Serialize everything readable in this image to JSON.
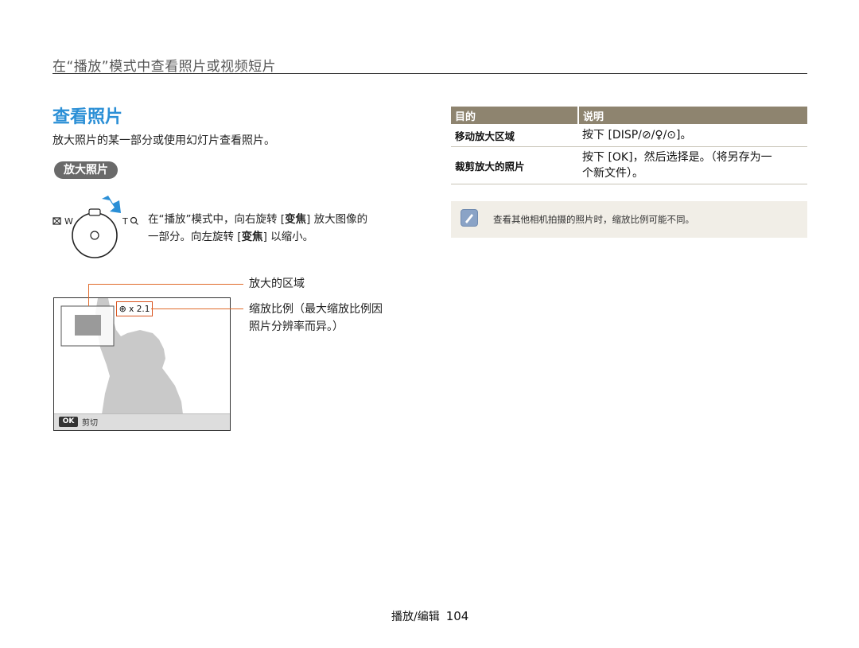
{
  "section_title": "在“播放”模式中查看照片或视频短片",
  "heading": "查看照片",
  "intro": "放大照片的某一部分或使用幻灯片查看照片。",
  "subsection": "放大照片",
  "dial": {
    "w_label": "W",
    "t_label": "T",
    "text_line1_pre": "在“播放”模式中，向右旋转 [",
    "text_line1_key": "变焦",
    "text_line1_post": "] 放大图像的",
    "text_line2_pre": "一部分。向左旋转 [",
    "text_line2_key": "变焦",
    "text_line2_post": "] 以缩小。"
  },
  "lcd": {
    "zoom_value": "x 2.1",
    "ok_button": "OK",
    "crop_label": "剪切"
  },
  "callouts": {
    "zoom_area": "放大的区域",
    "ratio_line1": "缩放比例（最大缩放比例因",
    "ratio_line2": "照片分辨率而异。）"
  },
  "table": {
    "headers": [
      "目的",
      "说明"
    ],
    "rows": [
      {
        "purpose": "移动放大区域",
        "desc_line1": "按下 [DISP/⊘/♀/⊙]。",
        "desc_line2": ""
      },
      {
        "purpose": "裁剪放大的照片",
        "desc_line1": "按下 [OK]，然后选择是。（将另存为一",
        "desc_line2": "个新文件）。"
      }
    ]
  },
  "note": "查看其他相机拍摄的照片时，缩放比例可能不同。",
  "footer": {
    "label": "播放/编辑",
    "page": "104"
  },
  "colors": {
    "accent_blue": "#2b8fd6",
    "table_header": "#8e846f",
    "callout": "#e06a2a",
    "note_bg": "#f1eee7"
  }
}
